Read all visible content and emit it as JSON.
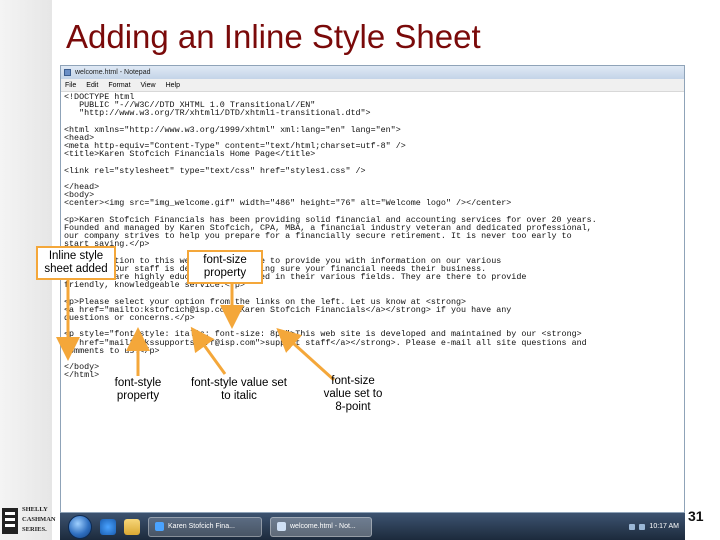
{
  "slide": {
    "title": "Adding an Inline Style Sheet",
    "page_number": "31",
    "logo_lines": [
      "SHELLY",
      "CASHMAN",
      "SERIES."
    ]
  },
  "window": {
    "title": "welcome.html - Notepad",
    "menu": [
      "File",
      "Edit",
      "Format",
      "View",
      "Help"
    ],
    "code_lines": [
      "<!DOCTYPE html",
      "   PUBLIC \"-//W3C//DTD XHTML 1.0 Transitional//EN\"",
      "   \"http://www.w3.org/TR/xhtml1/DTD/xhtml1-transitional.dtd\">",
      "",
      "<html xmlns=\"http://www.w3.org/1999/xhtml\" xml:lang=\"en\" lang=\"en\">",
      "<head>",
      "<meta http-equiv=\"Content-Type\" content=\"text/html;charset=utf-8\" />",
      "<title>Karen Stofcich Financials Home Page</title>",
      "",
      "<link rel=\"stylesheet\" type=\"text/css\" href=\"styles1.css\" />",
      "",
      "</head>",
      "<body>",
      "<center><img src=\"img_welcome.gif\" width=\"486\" height=\"76\" alt=\"Welcome logo\" /></center>",
      "",
      "<p>Karen Stofcich Financials has been providing solid financial and accounting services for over 20 years.",
      "Founded and managed by Karen Stofcich, CPA, MBA, a financial industry veteran and dedicated professional,",
      "our company strives to help you prepare for a financially secure retirement. It is never too early to",
      "start saving.</p>",
      "",
      "<p>In addition to this web site, we hope to provide you with information on our various",
      "services. Our staff is dedicated to making sure your financial needs their business.",
      "Our staff are highly educated and trained in their various fields. They are there to provide",
      "friendly, knowledgeable service.</p>",
      "",
      "<p>Please select your option from the links on the left. Let us know at <strong>",
      "<a href=\"mailto:kstofcich@isp.com\">Karen Stofcich Financials</a></strong> if you have any",
      "questions or concerns.</p>",
      "",
      "<p style=\"font-style: italic; font-size: 8pt\">This web site is developed and maintained by our <strong>",
      "<a href=\"mailto:kssupportstaff@isp.com\">support staff</a></strong>. Please e-mail all site questions and",
      "comments to us.</p>",
      "",
      "</body>",
      "</html>"
    ]
  },
  "taskbar": {
    "tasks": [
      "Karen Stofcich Fina...",
      "welcome.html - Not..."
    ],
    "clock": "10:17 AM"
  },
  "callouts": {
    "inline_style": "Inline style sheet added",
    "font_size_property": "font-size property",
    "font_style_property": "font-style property",
    "font_style_value": "font-style value set to italic",
    "font_size_value": "font-size value set to 8-point"
  },
  "colors": {
    "title": "#7a0a0a",
    "callout_border": "#f4a73a",
    "arrow": "#f4a73a"
  }
}
